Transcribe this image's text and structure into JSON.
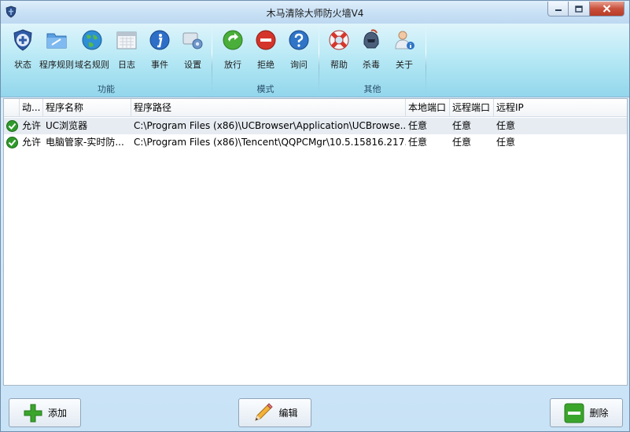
{
  "window": {
    "title": "木马清除大师防火墙V4"
  },
  "ribbon": {
    "groups": [
      {
        "label": "功能",
        "items": [
          {
            "label": "状态",
            "icon": "shield-plus-icon"
          },
          {
            "label": "程序规则",
            "icon": "folder-icon"
          },
          {
            "label": "域名规则",
            "icon": "globe-icon"
          },
          {
            "label": "日志",
            "icon": "calendar-icon"
          },
          {
            "label": "事件",
            "icon": "info-icon"
          },
          {
            "label": "设置",
            "icon": "gear-icon"
          }
        ]
      },
      {
        "label": "模式",
        "items": [
          {
            "label": "放行",
            "icon": "allow-icon"
          },
          {
            "label": "拒绝",
            "icon": "deny-icon"
          },
          {
            "label": "询问",
            "icon": "question-icon"
          }
        ]
      },
      {
        "label": "其他",
        "items": [
          {
            "label": "帮助",
            "icon": "lifebuoy-icon"
          },
          {
            "label": "杀毒",
            "icon": "helmet-icon"
          },
          {
            "label": "关于",
            "icon": "user-info-icon"
          }
        ]
      }
    ]
  },
  "table": {
    "columns": [
      "动...",
      "程序名称",
      "程序路径",
      "本地端口",
      "远程端口",
      "远程IP"
    ],
    "rows": [
      {
        "action": "允许",
        "name": "UC浏览器",
        "path": "C:\\Program Files (x86)\\UCBrowser\\Application\\UCBrowse...",
        "local_port": "任意",
        "remote_port": "任意",
        "remote_ip": "任意"
      },
      {
        "action": "允许",
        "name": "电脑管家-实时防...",
        "path": "C:\\Program Files (x86)\\Tencent\\QQPCMgr\\10.5.15816.217...",
        "local_port": "任意",
        "remote_port": "任意",
        "remote_ip": "任意"
      }
    ]
  },
  "buttons": {
    "add": "添加",
    "edit": "编辑",
    "delete": "删除"
  },
  "colors": {
    "ribbon": "#a6e1f1",
    "accent_green": "#3aa52b",
    "deny_red": "#d4342a",
    "close_red": "#c9513c"
  }
}
